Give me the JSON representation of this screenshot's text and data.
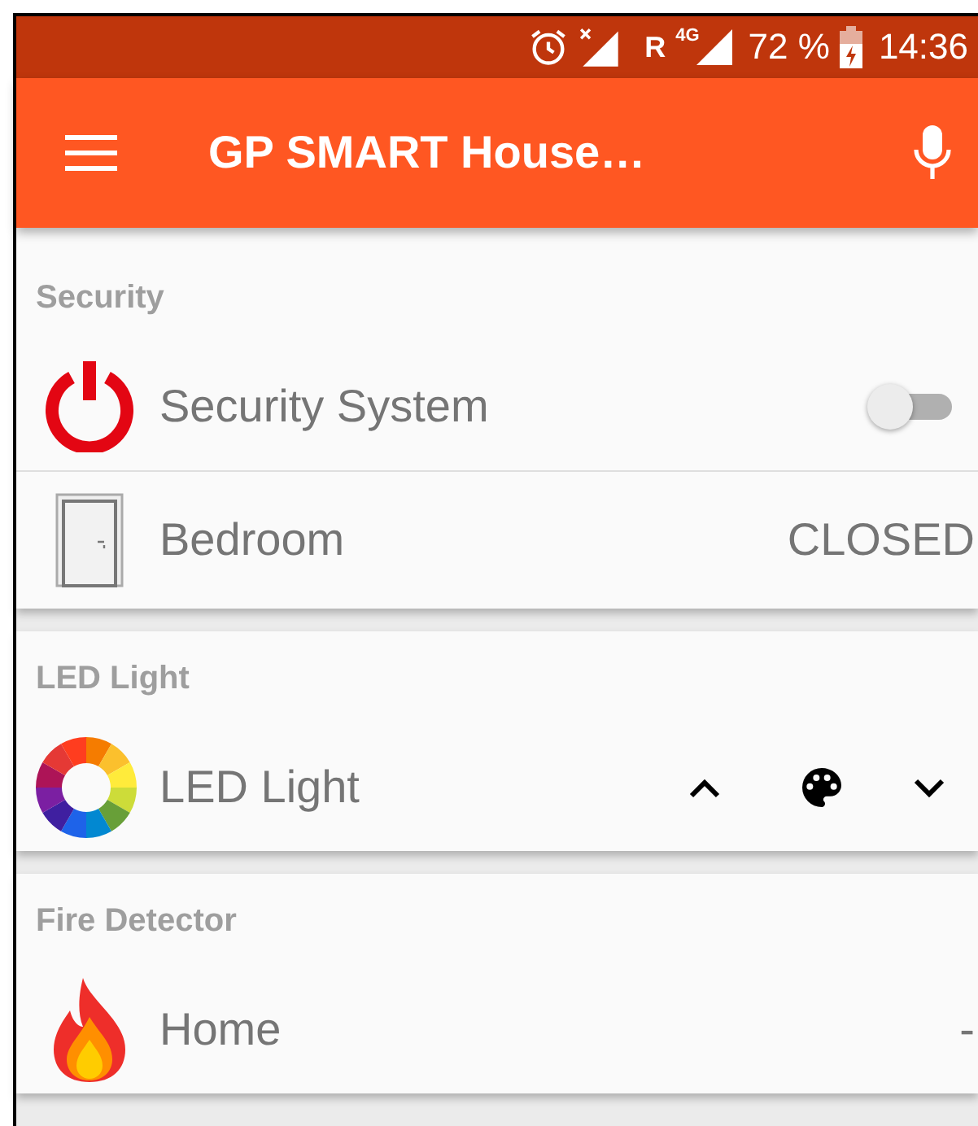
{
  "status_bar": {
    "roaming": "R",
    "network": "4G",
    "battery": "72 %",
    "time": "14:36"
  },
  "toolbar": {
    "title": "GP SMART House…"
  },
  "sections": [
    {
      "title": "Security",
      "items": [
        {
          "kind": "switch",
          "name": "Security System",
          "on": false
        },
        {
          "kind": "status",
          "name": "Bedroom",
          "value": "CLOSED"
        }
      ]
    },
    {
      "title": "LED Light",
      "items": [
        {
          "kind": "led",
          "name": "LED Light"
        }
      ]
    },
    {
      "title": "Fire Detector",
      "items": [
        {
          "kind": "status",
          "name": "Home",
          "value": "-"
        }
      ]
    }
  ]
}
